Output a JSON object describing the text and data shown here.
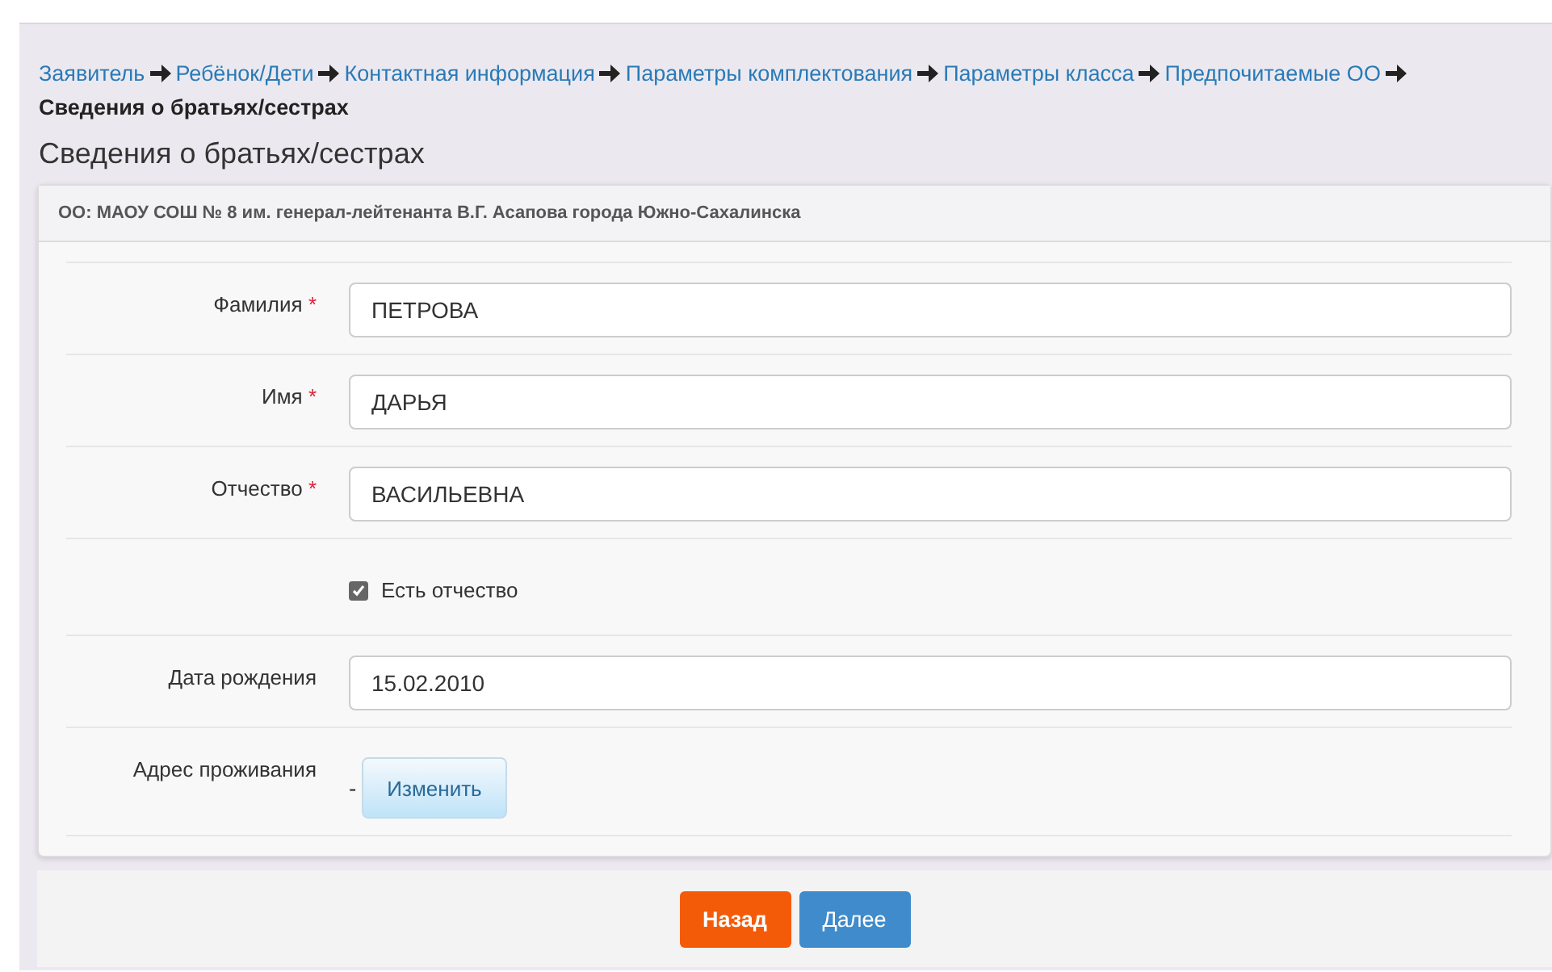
{
  "breadcrumbs": [
    {
      "label": "Заявитель",
      "current": false
    },
    {
      "label": "Ребёнок/Дети",
      "current": false
    },
    {
      "label": "Контактная информация",
      "current": false
    },
    {
      "label": "Параметры комплектования",
      "current": false
    },
    {
      "label": "Параметры класса",
      "current": false
    },
    {
      "label": "Предпочитаемые ОО",
      "current": false
    },
    {
      "label": "Сведения о братьях/сестрах",
      "current": true
    }
  ],
  "title": "Сведения о братьях/сестрах",
  "panel": {
    "header": "ОО: МАОУ СОШ № 8 им. генерал-лейтенанта В.Г. Асапова города Южно-Сахалинска",
    "rows": [
      {
        "kind": "text",
        "label": "Фамилия",
        "marker": "*",
        "value": "ПЕТРОВА"
      },
      {
        "kind": "text",
        "label": "Имя",
        "marker": "*",
        "value": "ДАРЬЯ"
      },
      {
        "kind": "text",
        "label": "Отчество",
        "marker": "*",
        "value": "ВАСИЛЬЕВНА"
      },
      {
        "kind": "checkbox",
        "label": "Есть отчество",
        "checked": true
      },
      {
        "kind": "text",
        "label": "Дата рождения",
        "value": "15.02.2010"
      },
      {
        "kind": "address",
        "label": "Адрес проживания",
        "value": "-",
        "button": "Изменить"
      }
    ]
  },
  "buttons": [
    {
      "label": "Назад",
      "kind": "back"
    },
    {
      "label": "Далее",
      "kind": "next"
    }
  ]
}
